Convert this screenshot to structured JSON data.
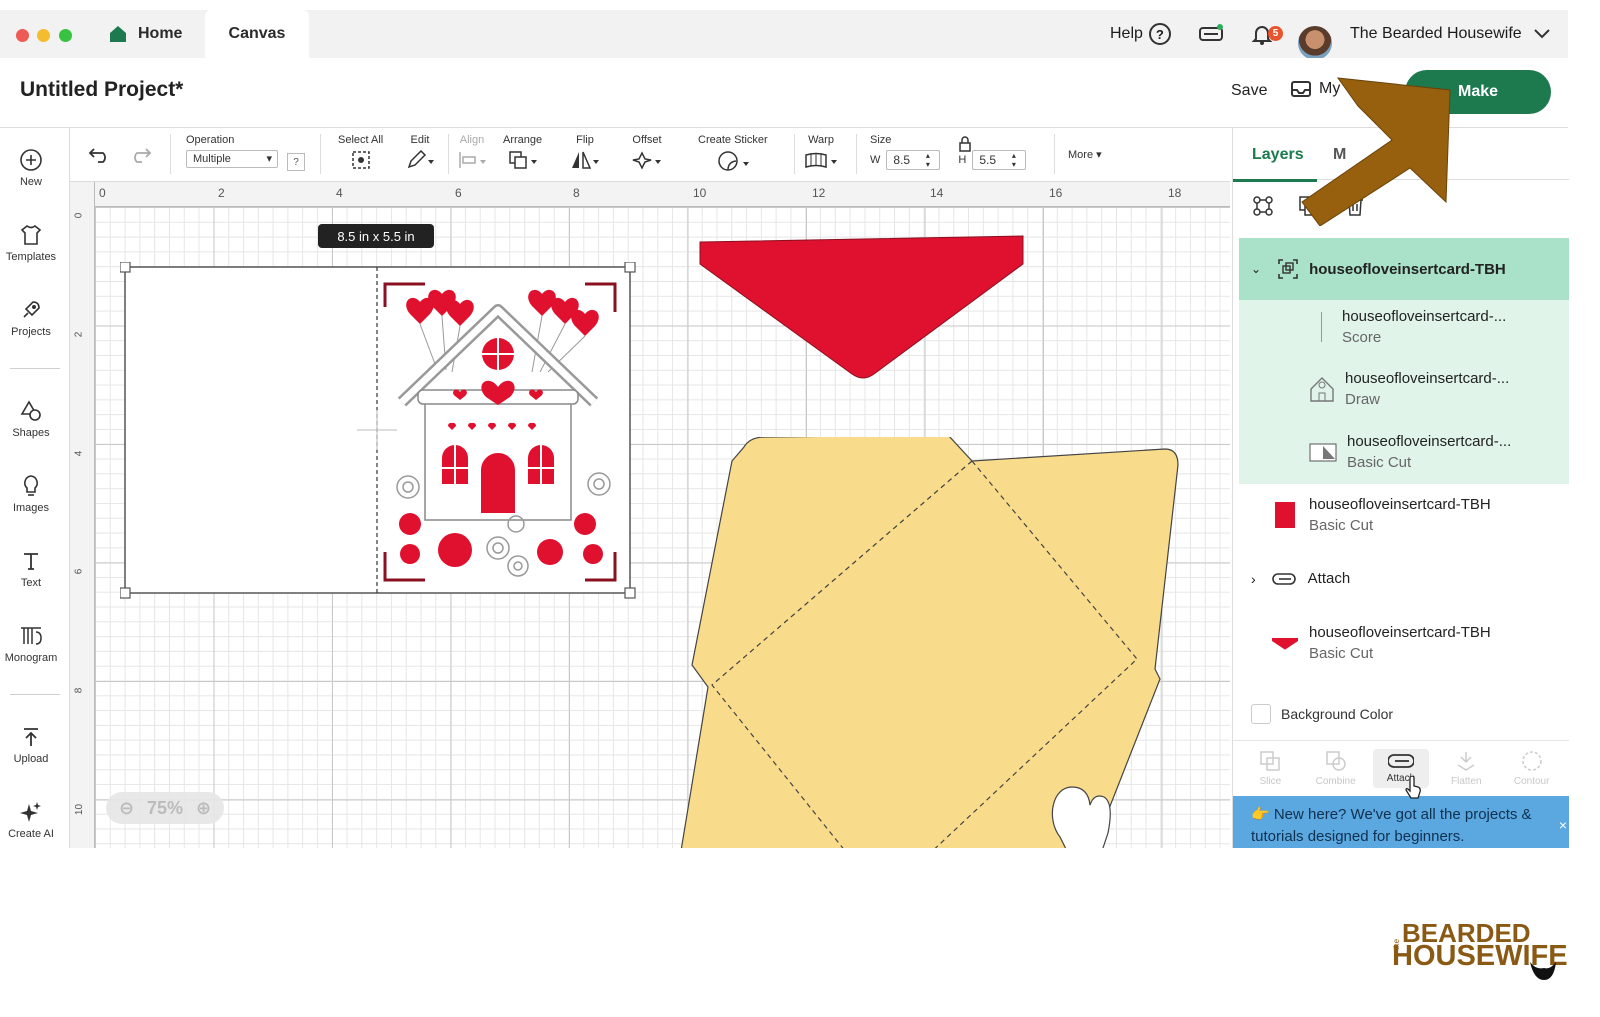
{
  "window": {
    "tabs": {
      "home": "Home",
      "canvas": "Canvas"
    },
    "help": "Help",
    "help_icon": "?",
    "notifications": "5",
    "user_name": "The Bearded Housewife"
  },
  "header": {
    "title": "Untitled Project*",
    "save": "Save",
    "my_projects": "My",
    "make": "Make"
  },
  "sidebar": {
    "items": [
      "New",
      "Templates",
      "Projects",
      "Shapes",
      "Images",
      "Text",
      "Monogram",
      "Upload",
      "Create AI"
    ]
  },
  "toolbar": {
    "operation_label": "Operation",
    "operation_value": "Multiple",
    "operation_help": "?",
    "select_all": "Select All",
    "edit": "Edit",
    "align": "Align",
    "arrange": "Arrange",
    "flip": "Flip",
    "offset": "Offset",
    "create_sticker": "Create Sticker",
    "warp": "Warp",
    "size": "Size",
    "w_label": "W",
    "w_value": "8.5",
    "h_label": "H",
    "h_value": "5.5",
    "more": "More"
  },
  "canvas": {
    "ruler_top": [
      "0",
      "2",
      "4",
      "6",
      "8",
      "10",
      "12",
      "14",
      "16",
      "18"
    ],
    "ruler_left": [
      "0",
      "2",
      "4",
      "6",
      "8",
      "10"
    ],
    "size_tooltip": "8.5  in x 5.5  in",
    "zoom": "75%"
  },
  "layers_panel": {
    "tabs": [
      "Layers",
      "M"
    ],
    "group_name": "houseofloveinsertcard-TBH",
    "children": [
      {
        "name": "houseofloveinsertcard-...",
        "type": "Score"
      },
      {
        "name": "houseofloveinsertcard-...",
        "type": "Draw"
      },
      {
        "name": "houseofloveinsertcard-...",
        "type": "Basic Cut"
      }
    ],
    "layers": [
      {
        "name": "houseofloveinsertcard-TBH",
        "type": "Basic Cut",
        "color": "#e0102f"
      },
      {
        "name": "Attach"
      },
      {
        "name": "houseofloveinsertcard-TBH",
        "type": "Basic Cut",
        "color": "#e0102f"
      }
    ],
    "background_color": "Background Color",
    "bottom_tools": [
      "Slice",
      "Combine",
      "Attach",
      "Flatten",
      "Contour"
    ],
    "banner": "👉 New here? We've got all the projects & tutorials designed for beginners.",
    "banner_close": "×"
  },
  "watermark": {
    "small": "the",
    "line1": "BEARDED",
    "line2": "HOUSEWIFE"
  },
  "colors": {
    "make_green": "#1c7a4e",
    "selected_layer": "#a9e2c8",
    "card_red": "#e0102f",
    "envelope_yellow": "#f9dc8b",
    "arrow_brown": "#96600f",
    "banner_blue": "#5aa8df"
  }
}
